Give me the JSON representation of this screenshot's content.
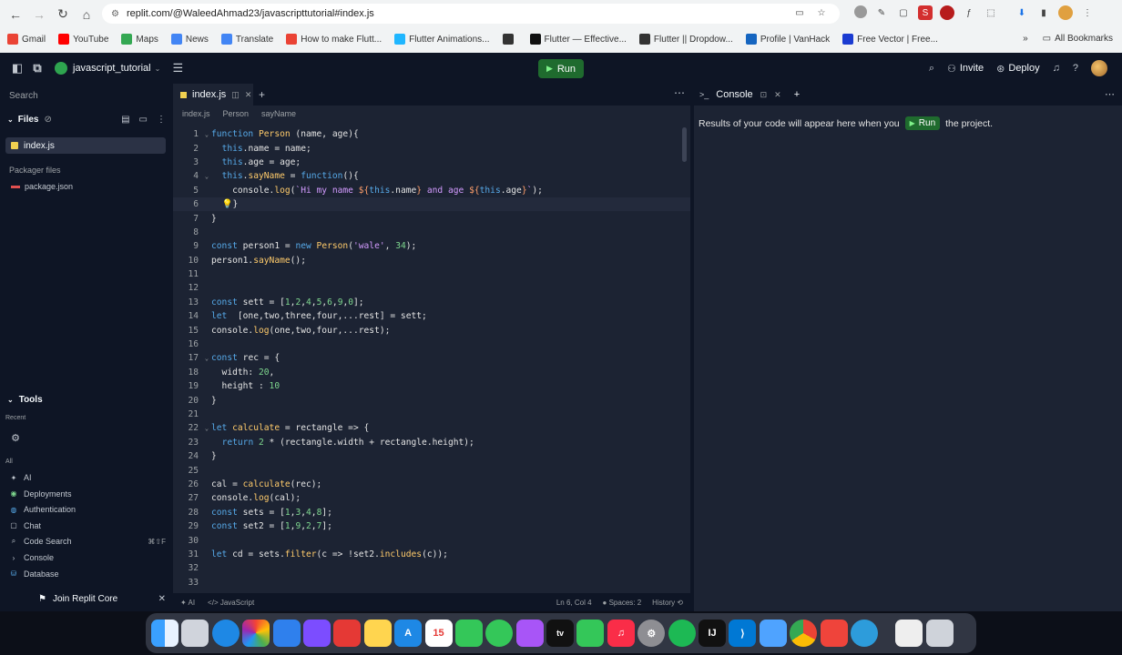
{
  "browser": {
    "url": "replit.com/@WaleedAhmad23/javascripttutorial#index.js",
    "bookmarks": [
      {
        "label": "Gmail",
        "color": "#ea4335"
      },
      {
        "label": "YouTube",
        "color": "#ff0000"
      },
      {
        "label": "Maps",
        "color": "#34a853"
      },
      {
        "label": "News",
        "color": "#4285f4"
      },
      {
        "label": "Translate",
        "color": "#4285f4"
      },
      {
        "label": "How to make Flutt...",
        "color": "#ea4335"
      },
      {
        "label": "Flutter Animations...",
        "color": "#1fb6ff"
      },
      {
        "label": "",
        "color": "#333333"
      },
      {
        "label": "Flutter — Effective...",
        "color": "#111111"
      },
      {
        "label": "Flutter || Dropdow...",
        "color": "#333333"
      },
      {
        "label": "Profile | VanHack",
        "color": "#1565c0"
      },
      {
        "label": "Free Vector | Free...",
        "color": "#1a3bd1"
      }
    ],
    "all_bookmarks": "All Bookmarks"
  },
  "header": {
    "repl_name": "javascript_tutorial",
    "run_label": "Run",
    "invite_label": "Invite",
    "deploy_label": "Deploy"
  },
  "sidebar": {
    "search_label": "Search",
    "files_label": "Files",
    "selected_file": "index.js",
    "packager_label": "Packager files",
    "package_file": "package.json",
    "tools_label": "Tools",
    "recent_label": "Recent",
    "all_label": "All",
    "tools": [
      {
        "label": "AI",
        "icon": "ai-icon",
        "color": "#c2c8d0",
        "shortcut": ""
      },
      {
        "label": "Deployments",
        "icon": "deployments-icon",
        "color": "#7fd88f",
        "shortcut": ""
      },
      {
        "label": "Authentication",
        "icon": "authentication-icon",
        "color": "#56a9e8",
        "shortcut": ""
      },
      {
        "label": "Chat",
        "icon": "chat-icon",
        "color": "#c2c8d0",
        "shortcut": ""
      },
      {
        "label": "Code Search",
        "icon": "code-search-icon",
        "color": "#c2c8d0",
        "shortcut": "⌘⇧F"
      },
      {
        "label": "Console",
        "icon": "console-icon",
        "color": "#c2c8d0",
        "shortcut": ""
      },
      {
        "label": "Database",
        "icon": "database-icon",
        "color": "#56a9e8",
        "shortcut": ""
      }
    ],
    "join_label": "Join Replit Core"
  },
  "editor": {
    "tab_label": "index.js",
    "breadcrumb": [
      "index.js",
      "Person",
      "sayName"
    ],
    "status_ai": "AI",
    "status_lang": "JavaScript",
    "status_pos": "Ln 6, Col 4",
    "status_spaces": "Spaces: 2",
    "status_history": "History"
  },
  "console": {
    "tab_label": "Console",
    "msg_before": "Results of your code will appear here when you",
    "run_label": "Run",
    "msg_after": "the project."
  }
}
